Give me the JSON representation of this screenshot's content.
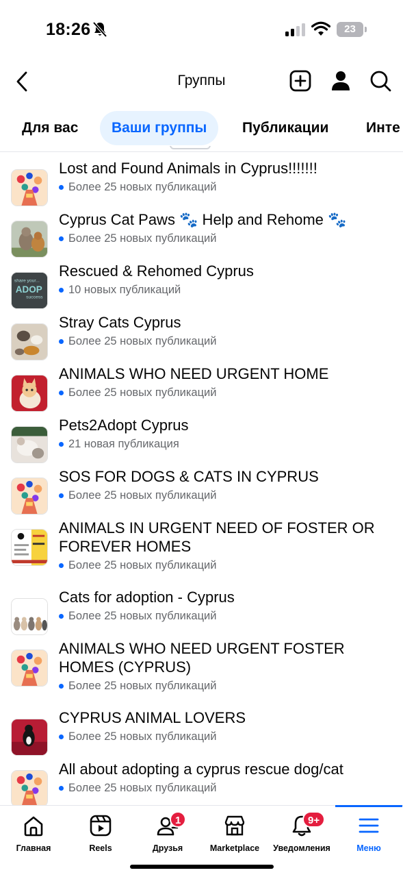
{
  "status_bar": {
    "time": "18:26",
    "battery": "23"
  },
  "header": {
    "title": "Группы"
  },
  "tabs": [
    {
      "label": "Для вас"
    },
    {
      "label": "Ваши группы"
    },
    {
      "label": "Публикации"
    },
    {
      "label": "Инте"
    }
  ],
  "groups": [
    {
      "name": "Lost and Found Animals in Cyprus!!!!!!!",
      "activity": "Более 25 новых публикаций"
    },
    {
      "name": "Cyprus Cat Paws 🐾 Help and Rehome 🐾",
      "activity": "Более 25 новых публикаций"
    },
    {
      "name": "Rescued & Rehomed Cyprus",
      "activity": "10 новых публикаций"
    },
    {
      "name": "Stray Cats Cyprus",
      "activity": "Более 25 новых публикаций"
    },
    {
      "name": "ANIMALS WHO NEED URGENT HOME",
      "activity": "Более 25 новых публикаций"
    },
    {
      "name": "Pets2Adopt Cyprus",
      "activity": "21 новая публикация"
    },
    {
      "name": "SOS FOR DOGS & CATS IN CYPRUS",
      "activity": "Более 25 новых публикаций"
    },
    {
      "name": "ANIMALS IN URGENT NEED OF FOSTER OR FOREVER HOMES",
      "activity": "Более 25 новых публикаций"
    },
    {
      "name": "Cats for adoption - Cyprus",
      "activity": "Более 25 новых публикаций"
    },
    {
      "name": "ANIMALS WHO NEED URGENT FOSTER HOMES (CYPRUS)",
      "activity": "Более 25 новых публикаций"
    },
    {
      "name": "CYPRUS ANIMAL LOVERS",
      "activity": "Более 25 новых публикаций"
    },
    {
      "name": "All about adopting a cyprus rescue dog/cat",
      "activity": "Более 25 новых публикаций"
    }
  ],
  "thumb_text": {
    "adopt_top": "share your...",
    "adopt_main": "ADOP",
    "adopt_sub": "success"
  },
  "bottom_nav": [
    {
      "label": "Главная",
      "icon": "home-icon"
    },
    {
      "label": "Reels",
      "icon": "reels-icon"
    },
    {
      "label": "Друзья",
      "icon": "friends-icon",
      "badge": "1"
    },
    {
      "label": "Marketplace",
      "icon": "marketplace-icon"
    },
    {
      "label": "Уведомления",
      "icon": "bell-icon",
      "badge": "9+"
    },
    {
      "label": "Меню",
      "icon": "menu-icon"
    }
  ],
  "colors": {
    "accent": "#0866ff",
    "badge": "#e41e3f",
    "muted": "#65676b",
    "tab_active_bg": "#e7f3ff"
  }
}
